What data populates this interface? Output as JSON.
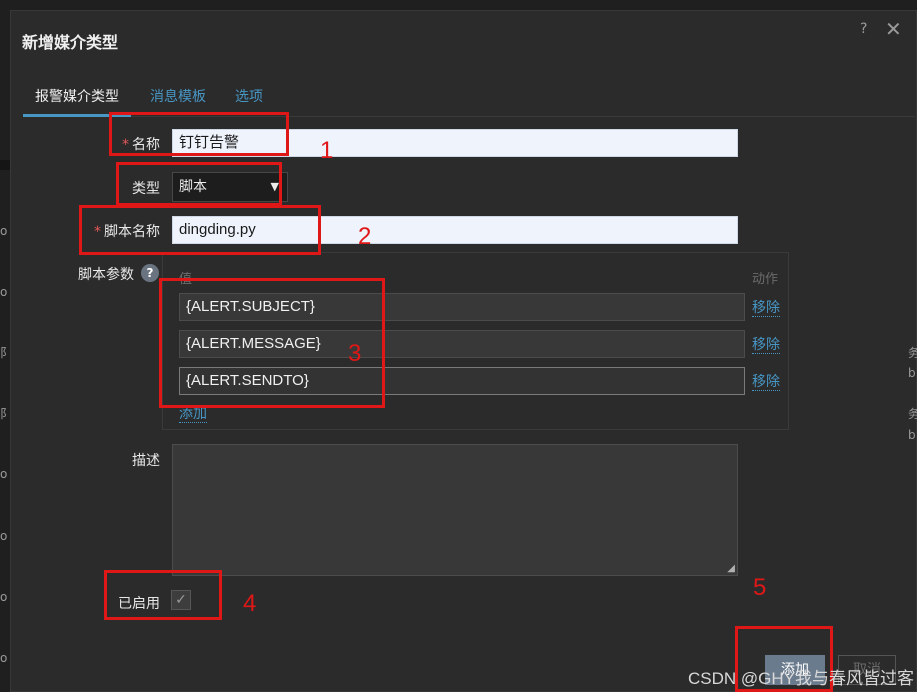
{
  "dialog": {
    "title": "新增媒介类型",
    "help_icon": "?",
    "close_icon": "✕"
  },
  "background": {
    "left_text": [
      "o",
      "o",
      "阝",
      "阝",
      "o",
      "o",
      "o",
      "o"
    ],
    "right_text": [
      "务",
      "b",
      "务",
      "b"
    ]
  },
  "tabs": [
    "报警媒介类型",
    "消息模板",
    "选项"
  ],
  "form": {
    "name_label": "名称",
    "name_value": "钉钉告警",
    "type_label": "类型",
    "type_value": "脚本",
    "script_name_label": "脚本名称",
    "script_name_value": "dingding.py",
    "params_label": "脚本参数",
    "params_help": "?",
    "params_col_value": "值",
    "params_col_action": "动作",
    "params": [
      {
        "value": "{ALERT.SUBJECT}",
        "action": "移除"
      },
      {
        "value": "{ALERT.MESSAGE}",
        "action": "移除"
      },
      {
        "value": " {ALERT.SENDTO}",
        "action": "移除"
      }
    ],
    "add_param": "添加",
    "description_label": "描述",
    "description_value": "",
    "enabled_label": "已启用",
    "enabled_check": "✓"
  },
  "buttons": {
    "add": "添加",
    "cancel": "取消"
  },
  "annotations": [
    "1",
    "2",
    "3",
    "4",
    "5"
  ],
  "watermark": "CSDN @GHY我与春风皆过客",
  "colors": {
    "accent": "#4796c4",
    "annotation_red": "#e01717",
    "dialog_bg": "#2b2b2b",
    "input_bg": "#eef3fc"
  }
}
